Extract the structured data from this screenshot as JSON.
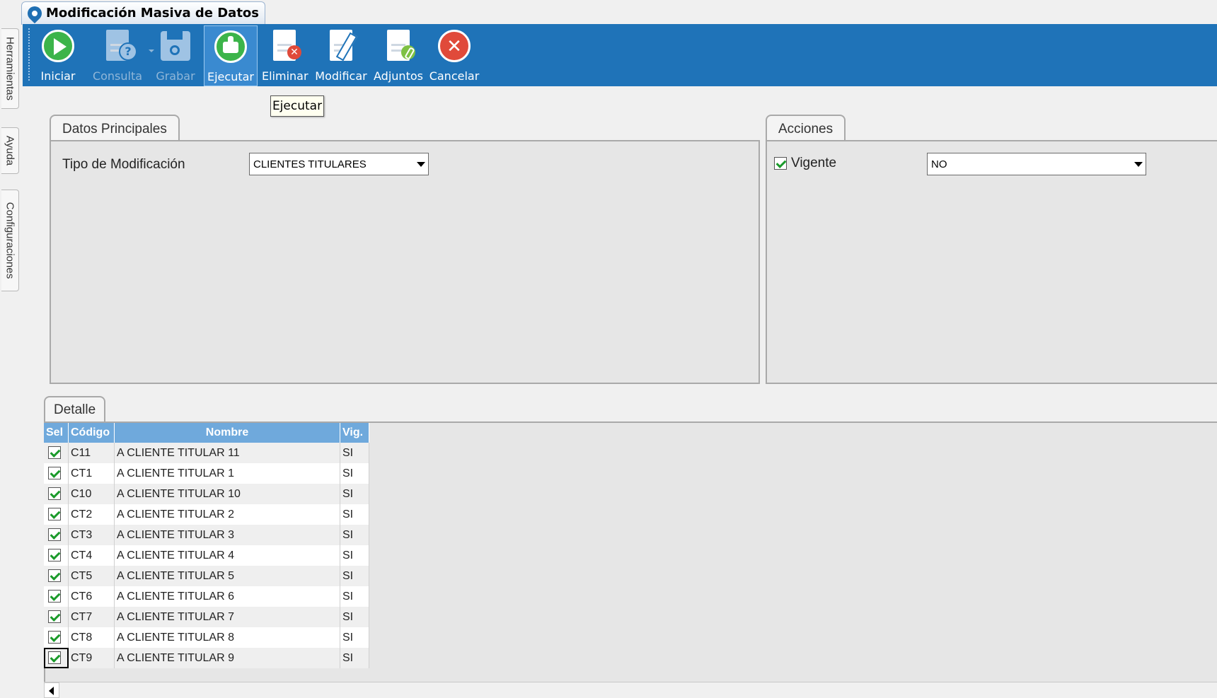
{
  "window": {
    "title": "Modificación Masiva de Datos"
  },
  "side_tabs": [
    "Herramientas",
    "Ayuda",
    "Configuraciones"
  ],
  "toolbar": {
    "buttons": [
      {
        "label": "Iniciar",
        "icon": "play-icon",
        "enabled": true
      },
      {
        "label": "Consulta",
        "icon": "query-document-icon",
        "enabled": false
      },
      {
        "label": "Grabar",
        "icon": "save-disk-icon",
        "enabled": false
      },
      {
        "label": "Ejecutar",
        "icon": "thumbs-up-icon",
        "enabled": true,
        "active": true
      },
      {
        "label": "Eliminar",
        "icon": "delete-document-icon",
        "enabled": true
      },
      {
        "label": "Modificar",
        "icon": "edit-document-icon",
        "enabled": true
      },
      {
        "label": "Adjuntos",
        "icon": "attachment-document-icon",
        "enabled": true
      },
      {
        "label": "Cancelar",
        "icon": "cancel-x-icon",
        "enabled": true
      }
    ],
    "tooltip": "Ejecutar"
  },
  "datos_principales": {
    "tab_label": "Datos Principales",
    "tipo_label": "Tipo de Modificación",
    "tipo_value": "CLIENTES TITULARES"
  },
  "acciones": {
    "tab_label": "Acciones",
    "vigente_label": "Vigente",
    "vigente_checked": true,
    "vigente_value": "NO"
  },
  "detalle": {
    "tab_label": "Detalle",
    "columns": [
      "Sel",
      "Código",
      "Nombre",
      "Vig."
    ],
    "rows": [
      {
        "sel": true,
        "codigo": "C11",
        "nombre": "A CLIENTE TITULAR  11",
        "vig": "SI"
      },
      {
        "sel": true,
        "codigo": "CT1",
        "nombre": "A CLIENTE TITULAR 1",
        "vig": "SI"
      },
      {
        "sel": true,
        "codigo": "C10",
        "nombre": "A CLIENTE TITULAR 10",
        "vig": "SI"
      },
      {
        "sel": true,
        "codigo": "CT2",
        "nombre": "A CLIENTE TITULAR 2",
        "vig": "SI"
      },
      {
        "sel": true,
        "codigo": "CT3",
        "nombre": "A CLIENTE TITULAR 3",
        "vig": "SI"
      },
      {
        "sel": true,
        "codigo": "CT4",
        "nombre": "A CLIENTE TITULAR 4",
        "vig": "SI"
      },
      {
        "sel": true,
        "codigo": "CT5",
        "nombre": "A CLIENTE TITULAR 5",
        "vig": "SI"
      },
      {
        "sel": true,
        "codigo": "CT6",
        "nombre": "A CLIENTE TITULAR 6",
        "vig": "SI"
      },
      {
        "sel": true,
        "codigo": "CT7",
        "nombre": "A CLIENTE TITULAR 7",
        "vig": "SI"
      },
      {
        "sel": true,
        "codigo": "CT8",
        "nombre": "A CLIENTE TITULAR 8",
        "vig": "SI"
      },
      {
        "sel": true,
        "codigo": "CT9",
        "nombre": "A CLIENTE TITULAR 9",
        "vig": "SI"
      }
    ]
  },
  "colors": {
    "toolbar_bg": "#1f73b8",
    "grid_header": "#6fa9dc",
    "panel_bg": "#e6e6e6",
    "check_green": "#1a9a2a",
    "cancel_red": "#e04a3a",
    "play_green": "#3cb44a"
  }
}
